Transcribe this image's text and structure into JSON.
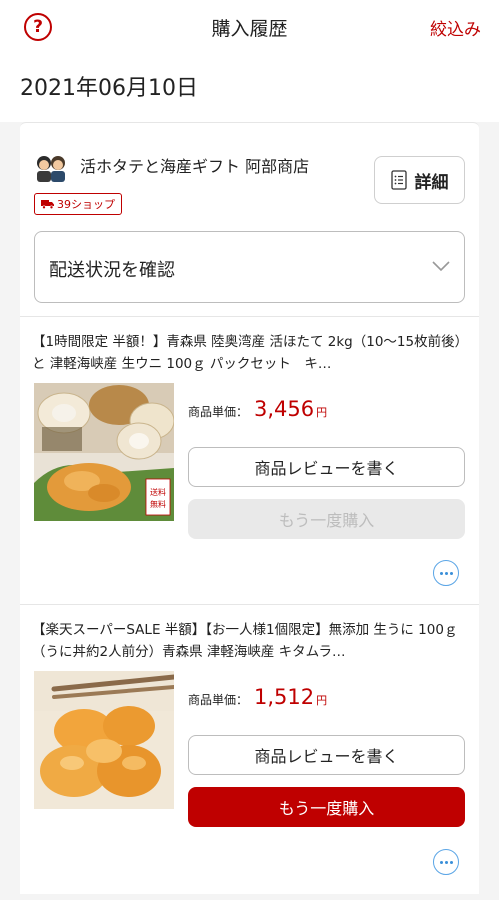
{
  "header": {
    "help_icon": "?",
    "title": "購入履歴",
    "filter_label": "絞込み"
  },
  "order": {
    "date": "2021年06月10日",
    "shop": {
      "name": "活ホタテと海産ギフト 阿部商店",
      "badge": "39ショップ",
      "detail_label": "詳細"
    },
    "shipping_select": {
      "label": "配送状況を確認"
    },
    "items": [
      {
        "title": "【1時間限定 半額！】青森県 陸奥湾産 活ほたて 2kg（10〜15枚前後）と 津軽海峡産 生ウニ 100ｇ パックセット　キ…",
        "price_label": "商品単価：",
        "price": "3,456",
        "price_unit": "円",
        "review_label": "商品レビューを書く",
        "rebuy_label": "もう一度購入",
        "rebuy_enabled": false,
        "image_caption": "送料無料"
      },
      {
        "title": "【楽天スーパーSALE 半額】【お一人様1個限定】無添加 生うに 100ｇ（うに丼約2人前分）青森県 津軽海峡産 キタムラ…",
        "price_label": "商品単価：",
        "price": "1,512",
        "price_unit": "円",
        "review_label": "商品レビューを書く",
        "rebuy_label": "もう一度購入",
        "rebuy_enabled": true
      }
    ]
  },
  "colors": {
    "accent": "#bf0000",
    "link_blue": "#3a8fd9"
  }
}
